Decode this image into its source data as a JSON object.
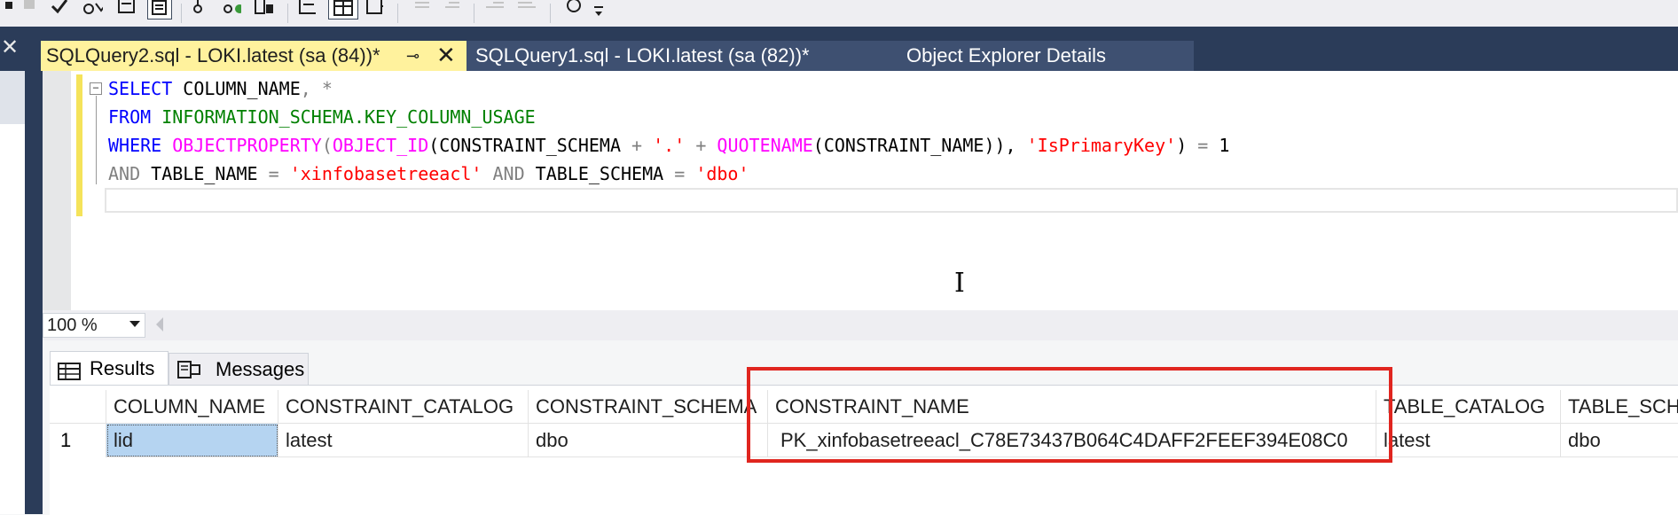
{
  "tabs": [
    {
      "label": "SQLQuery2.sql - LOKI.latest (sa (84))*",
      "active": true
    },
    {
      "label": "SQLQuery1.sql - LOKI.latest (sa (82))*"
    },
    {
      "label": "Object Explorer Details"
    }
  ],
  "editor": {
    "lines": [
      "SELECT COLUMN_NAME, *",
      "FROM INFORMATION_SCHEMA.KEY_COLUMN_USAGE",
      "WHERE OBJECTPROPERTY(OBJECT_ID(CONSTRAINT_SCHEMA + '.' + QUOTENAME(CONSTRAINT_NAME)), 'IsPrimaryKey') = 1",
      "AND TABLE_NAME = 'xinfobasetreeacl' AND TABLE_SCHEMA = 'dbo'"
    ],
    "tokens": {
      "l1": [
        "SELECT",
        " COLUMN_NAME",
        ", *"
      ],
      "l2": [
        "FROM",
        " INFORMATION_SCHEMA.KEY_COLUMN_USAGE"
      ],
      "l3": [
        "WHERE",
        " ",
        "OBJECTPROPERTY",
        "(",
        "OBJECT_ID",
        "(CONSTRAINT_SCHEMA ",
        "+",
        " ",
        "'.'",
        " ",
        "+",
        " ",
        "QUOTENAME",
        "(CONSTRAINT_NAME)), ",
        "'IsPrimaryKey'",
        ") ",
        "=",
        " 1"
      ],
      "l4": [
        "AND",
        " TABLE_NAME ",
        "=",
        " ",
        "'xinfobasetreeacl'",
        " ",
        "AND",
        " TABLE_SCHEMA ",
        "=",
        " ",
        "'dbo'"
      ]
    }
  },
  "zoom": {
    "value": "100 %"
  },
  "results": {
    "tabs": [
      {
        "label": "Results"
      },
      {
        "label": "Messages"
      }
    ],
    "columns": [
      "COLUMN_NAME",
      "CONSTRAINT_CATALOG",
      "CONSTRAINT_SCHEMA",
      "CONSTRAINT_NAME",
      "TABLE_CATALOG",
      "TABLE_SCH"
    ],
    "rows": [
      {
        "num": "1",
        "cells": [
          "lid",
          "latest",
          "dbo",
          "PK_xinfobasetreeacl_C78E73437B064C4DAFF2FEEF394E08C0",
          "latest",
          "dbo"
        ]
      }
    ]
  },
  "colors": {
    "accent_tab": "#fff29d",
    "chrome": "#2b3c59",
    "highlight_box": "#e0251f",
    "selection": "#b5d4f1"
  }
}
